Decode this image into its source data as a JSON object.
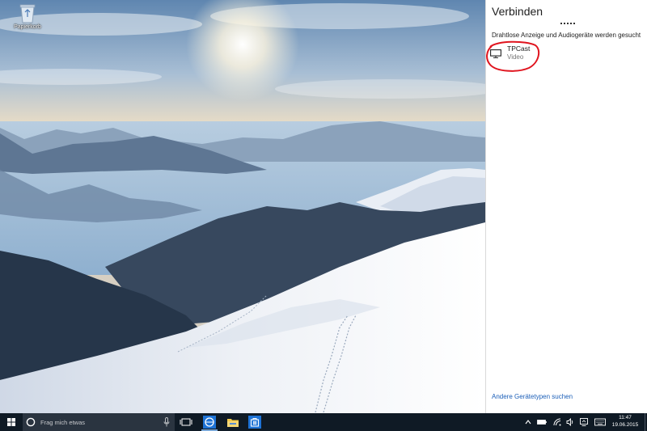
{
  "desktop": {
    "icons": [
      {
        "label": "Papierkorb",
        "icon": "recycle-bin-icon"
      }
    ]
  },
  "connect_panel": {
    "title": "Verbinden",
    "status": "Drahtlose Anzeige und Audiogeräte werden gesucht",
    "devices": [
      {
        "name": "TPCast",
        "type": "Video",
        "icon": "monitor-icon"
      }
    ],
    "more_link": "Andere Gerätetypen suchen",
    "annotation_color": "#e0141e"
  },
  "taskbar": {
    "search_placeholder": "Frag mich etwas",
    "pinned_apps": [
      "edge-icon",
      "file-explorer-icon",
      "store-icon"
    ],
    "tray_icons": [
      "chevron-up-icon",
      "battery-icon",
      "network-icon",
      "volume-icon",
      "connect-icon",
      "keyboard-icon"
    ],
    "clock_time": "11:47",
    "clock_date": "19.06.2015",
    "background": "#0f1a25",
    "accent": "#1c5fb8"
  }
}
